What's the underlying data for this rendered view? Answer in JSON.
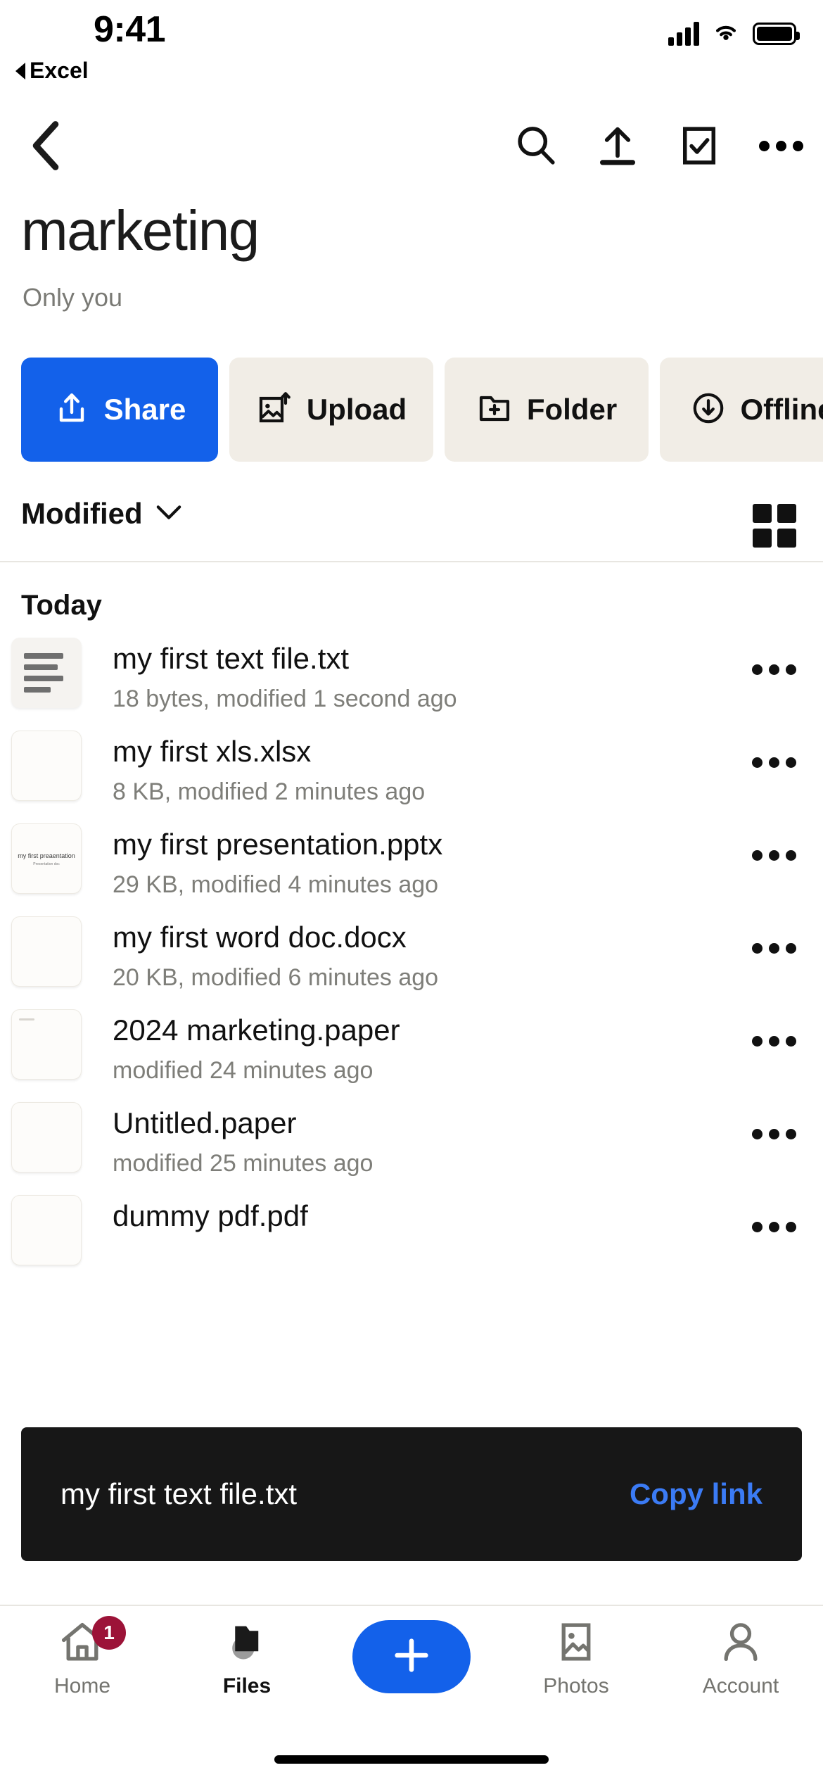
{
  "status_bar": {
    "time": "9:41",
    "back_app_label": "Excel",
    "signal_icon": "cellular-signal-icon",
    "wifi_icon": "wifi-icon",
    "battery_icon": "battery-icon"
  },
  "nav_bar": {
    "back_icon": "chevron-left-icon",
    "actions": [
      {
        "name": "search-icon",
        "label": "Search"
      },
      {
        "name": "upload-icon",
        "label": "Upload"
      },
      {
        "name": "select-checkbox-icon",
        "label": "Select"
      },
      {
        "name": "overflow-menu-icon",
        "label": "More"
      }
    ]
  },
  "header": {
    "title": "marketing",
    "subtitle": "Only you"
  },
  "action_chips": [
    {
      "label": "Share",
      "icon": "share-upload-icon",
      "primary": true
    },
    {
      "label": "Upload",
      "icon": "image-upload-icon",
      "primary": false
    },
    {
      "label": "Folder",
      "icon": "folder-plus-icon",
      "primary": false
    },
    {
      "label": "Offline",
      "icon": "cloud-download-icon",
      "primary": false
    }
  ],
  "sort_row": {
    "sort_label": "Modified",
    "sort_chevron_icon": "chevron-down-icon",
    "view_toggle_icon": "grid-view-icon"
  },
  "section": {
    "heading": "Today"
  },
  "files": [
    {
      "name": "my first text file.txt",
      "meta": "18 bytes, modified 1 second ago",
      "thumb": "text-file-thumbnail",
      "more_icon": "overflow-menu-icon"
    },
    {
      "name": "my first xls.xlsx",
      "meta": "8 KB, modified 2 minutes ago",
      "thumb": "spreadsheet-thumbnail",
      "more_icon": "overflow-menu-icon"
    },
    {
      "name": "my first presentation.pptx",
      "meta": "29 KB, modified 4 minutes ago",
      "thumb": "presentation-thumbnail",
      "more_icon": "overflow-menu-icon",
      "preview_title": "my first preaentation",
      "preview_subtitle": "Presentation doc"
    },
    {
      "name": "my first word doc.docx",
      "meta": "20 KB, modified 6 minutes ago",
      "thumb": "document-thumbnail",
      "more_icon": "overflow-menu-icon"
    },
    {
      "name": "2024 marketing.paper",
      "meta": "modified 24 minutes ago",
      "thumb": "paper-doc-thumbnail",
      "more_icon": "overflow-menu-icon"
    },
    {
      "name": "Untitled.paper",
      "meta": "modified 25 minutes ago",
      "thumb": "paper-doc-thumbnail",
      "more_icon": "overflow-menu-icon"
    },
    {
      "name": "dummy pdf.pdf",
      "meta": "",
      "thumb": "pdf-thumbnail",
      "more_icon": "overflow-menu-icon"
    }
  ],
  "toast": {
    "message": "my first text file.txt",
    "action_label": "Copy link"
  },
  "tab_bar": {
    "items": [
      {
        "label": "Home",
        "icon": "home-icon",
        "active": false,
        "badge": "1"
      },
      {
        "label": "Files",
        "icon": "folder-icon",
        "active": true,
        "badge": ""
      },
      {
        "label": "",
        "icon": "plus-icon",
        "active": false,
        "badge": ""
      },
      {
        "label": "Photos",
        "icon": "photos-icon",
        "active": false,
        "badge": ""
      },
      {
        "label": "Account",
        "icon": "person-icon",
        "active": false,
        "badge": ""
      }
    ]
  },
  "colors": {
    "accent_blue": "#1361ea",
    "chip_bg": "#f1ede6",
    "toast_bg": "#171717",
    "toast_link": "#3b7bf5",
    "badge_bg": "#9c1338",
    "muted_text": "#7e7e79"
  }
}
